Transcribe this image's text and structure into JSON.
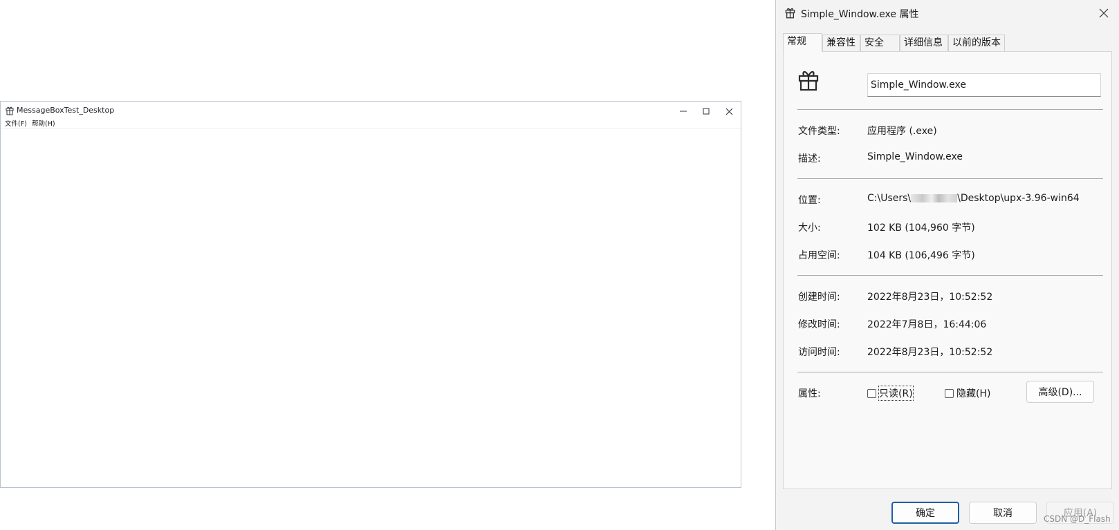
{
  "app_window": {
    "title": "MessageBoxTest_Desktop",
    "icon": "gift-icon",
    "menu": [
      {
        "label": "文件(F)"
      },
      {
        "label": "帮助(H)"
      }
    ]
  },
  "properties_dialog": {
    "title": "Simple_Window.exe 属性",
    "icon": "gift-icon",
    "tabs": [
      {
        "label": "常规",
        "active": true
      },
      {
        "label": "兼容性"
      },
      {
        "label": "安全"
      },
      {
        "label": "详细信息"
      },
      {
        "label": "以前的版本"
      }
    ],
    "file_name_value": "Simple_Window.exe",
    "rows": {
      "file_type": {
        "label": "文件类型:",
        "value": "应用程序 (.exe)"
      },
      "description": {
        "label": "描述:",
        "value": "Simple_Window.exe"
      },
      "location": {
        "label": "位置:",
        "value_prefix": "C:\\Users\\",
        "value_suffix": "\\Desktop\\upx-3.96-win64"
      },
      "size": {
        "label": "大小:",
        "value": "102 KB (104,960 字节)"
      },
      "size_on_disk": {
        "label": "占用空间:",
        "value": "104 KB (106,496 字节)"
      },
      "created": {
        "label": "创建时间:",
        "value": "2022年8月23日，10:52:52"
      },
      "modified": {
        "label": "修改时间:",
        "value": "2022年7月8日，16:44:06"
      },
      "accessed": {
        "label": "访问时间:",
        "value": "2022年8月23日，10:52:52"
      }
    },
    "attributes": {
      "label": "属性:",
      "readonly": {
        "label": "只读(R)",
        "checked": false
      },
      "hidden": {
        "label": "隐藏(H)",
        "checked": false
      },
      "advanced_button": "高级(D)..."
    },
    "buttons": {
      "ok": "确定",
      "cancel": "取消",
      "apply": "应用(A)"
    },
    "watermark": "CSDN @D_Flash"
  }
}
